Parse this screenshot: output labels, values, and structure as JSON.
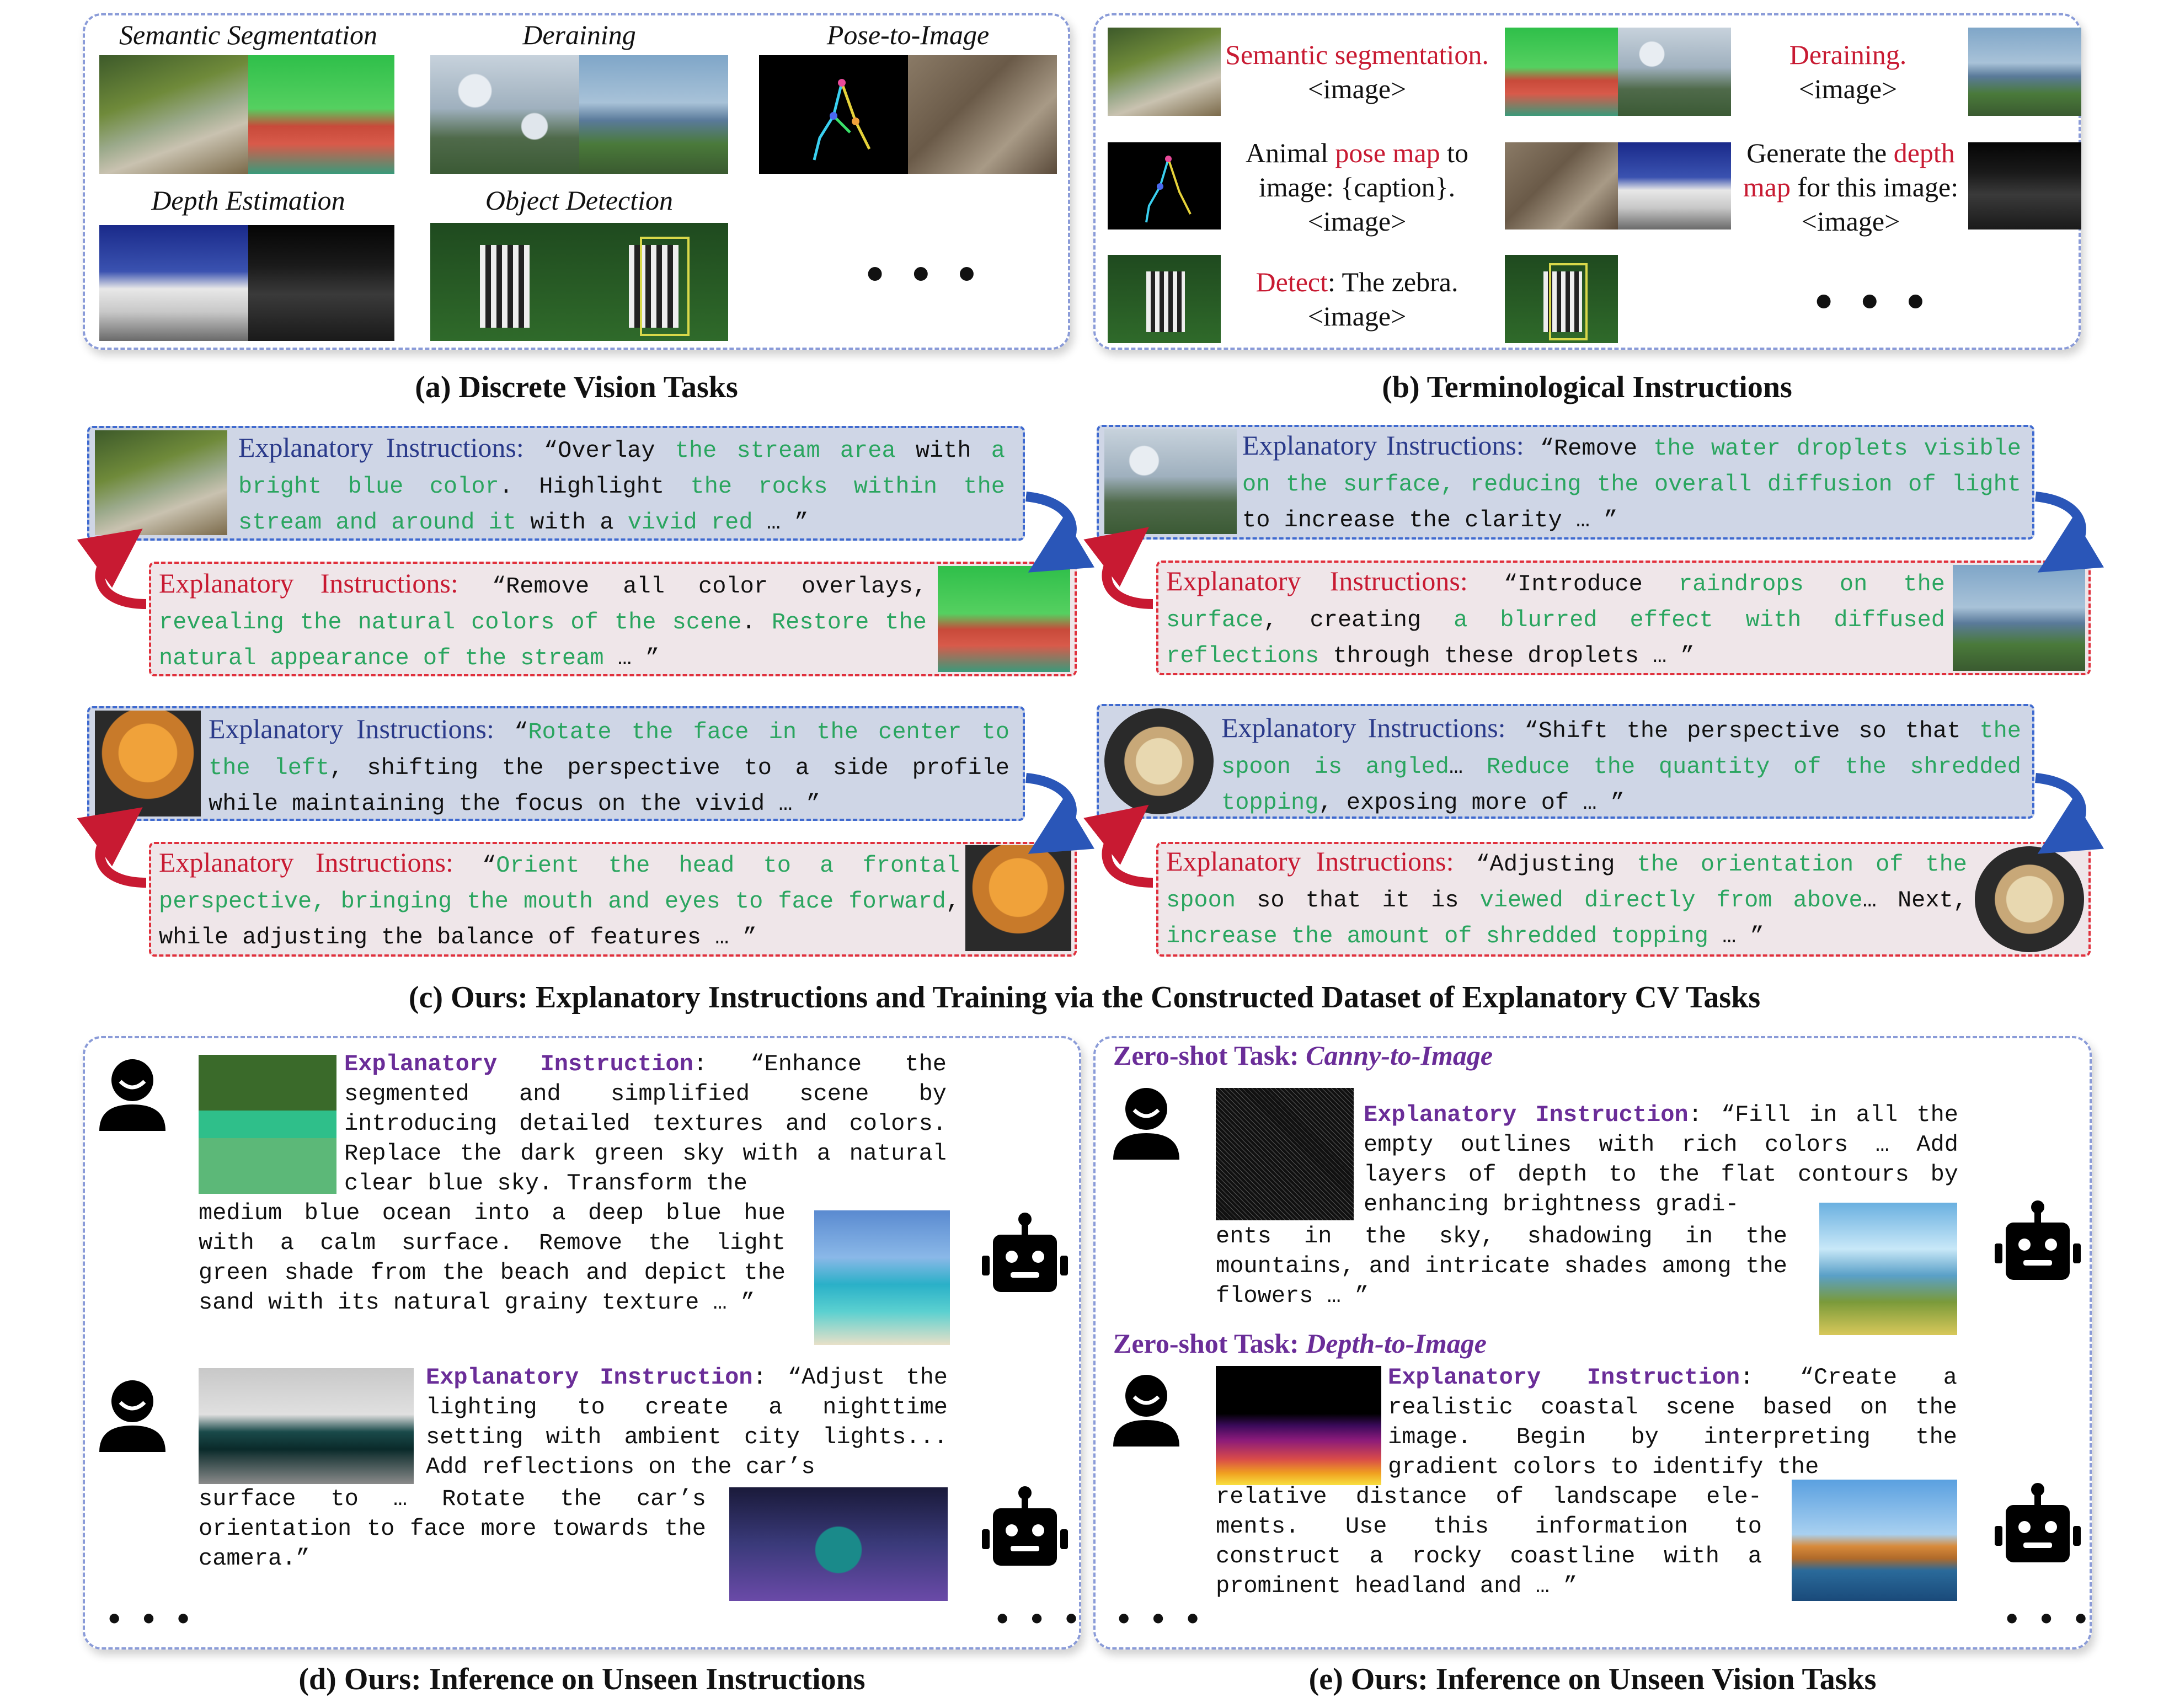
{
  "panel_a": {
    "caption": "(a) Discrete Vision Tasks",
    "tasks": [
      "Semantic Segmentation",
      "Deraining",
      "Pose-to-Image",
      "Depth Estimation",
      "Object Detection"
    ],
    "more": "• • •"
  },
  "panel_b": {
    "caption": "(b) Terminological Instructions",
    "seg": {
      "kw": "Semantic segmentation.",
      "img": "<image>"
    },
    "derain": {
      "kw": "Deraining.",
      "img": "<image>"
    },
    "pose": {
      "pre": "Animal ",
      "kw": "pose map",
      "post": " to image: {caption}.",
      "img": "<image>"
    },
    "depth": {
      "pre": "Generate the ",
      "kw": "depth map",
      "post": " for this image:",
      "img": "<image>"
    },
    "detect": {
      "kw": "Detect",
      "post": ": The zebra.",
      "img": "<image>"
    },
    "more": "• • •"
  },
  "panel_c": {
    "caption": "(c) Ours: Explanatory Instructions and Training via the Constructed Dataset of Explanatory CV Tasks",
    "label": "Explanatory Instructions:",
    "b1": {
      "q": " “",
      "t1": "Overlay ",
      "g1": "the stream area",
      "t2": " with ",
      "g2": "a bright blue color",
      "t3": ". Highlight ",
      "g3": "the rocks within the stream and around it",
      "t4": " with a ",
      "g4": "vivid red",
      "t5": " … ”"
    },
    "r1": {
      "q": " “",
      "t1": "Remove all color overlays, ",
      "g1": "revealing the natural colors of the scene",
      "t2": ". ",
      "g2": "Restore the natural appearance of the stream",
      "t3": " … ”"
    },
    "b2": {
      "q": " “",
      "t1": "Remove ",
      "g1": "the water droplets visible on the surface, reducing the overall diffusion of light",
      "t2": " to increase the clarity … ”"
    },
    "r2": {
      "q": " “",
      "t1": "Introduce ",
      "g1": "raindrops on the surface",
      "t2": ", creating ",
      "g2": "a blurred effect with diffused reflections",
      "t3": " through these droplets … ”"
    },
    "b3": {
      "q": " “",
      "g1": "Rotate the face in the center to the left",
      "t1": ", shifting the perspective to a side profile while maintaining the focus on the vivid … ”"
    },
    "r3": {
      "q": " “",
      "g1": "Orient the head to a frontal perspective, bringing the mouth and eyes to face forward",
      "t1": ", while adjusting the balance of features … ”"
    },
    "b4": {
      "q": " “",
      "t1": "Shift the perspective so that ",
      "g1": "the spoon is angled",
      "t2": "… ",
      "g2": "Reduce the quantity of the shredded topping",
      "t3": ", exposing more of … ”"
    },
    "r4": {
      "q": " “",
      "t1": "Adjusting ",
      "g1": "the orientation of the spoon",
      "t2": " so that it is ",
      "g2": "viewed directly from above",
      "t3": "… Next, ",
      "g3": "increase the amount of shredded topping",
      "t4": " … ”"
    }
  },
  "panel_d": {
    "caption": "(d) Ours: Inference on Unseen Instructions",
    "head": "Explanatory Instruction",
    "t1": ": “Enhance the segmented and simplified scene by introducing detailed textures and colors. Replace the dark green sky with a natural clear blue sky. Transform the",
    "t1b": "medium blue ocean into a deep blue hue with a calm surface. Remove the light green shade from the beach and depict the sand with its natural grainy texture … ”",
    "t2": ": “Adjust the lighting to create a nighttime setting with ambient city lights... Add reflections on the car’s",
    "t2b": "surface to … Rotate the car’s orientation to face more towards the camera.”",
    "more_left": "• • •",
    "more_right": "• • •"
  },
  "panel_e": {
    "caption": "(e) Ours: Inference on Unseen Vision Tasks",
    "z1_prefix": "Zero-shot Task: ",
    "z1_task": "Canny-to-Image",
    "z2_prefix": "Zero-shot Task: ",
    "z2_task": "Depth-to-Image",
    "head": "Explanatory Instruction",
    "t1": ": “Fill in all the empty outlines with rich colors … Add layers of depth to the flat contours by enhancing brightness gradi-",
    "t1b": "ents in the sky, shadowing in the mountains, and intricate shades among the flowers … ”",
    "t2": ": “Create a realistic coastal scene based on the image. Begin by interpreting the gradient colors to identify the",
    "t2b": "relative distance of landscape ele-ments. Use this information to construct a rocky coastline with a prominent headland and … ”",
    "more_left": "• • •",
    "more_right": "• • •"
  }
}
